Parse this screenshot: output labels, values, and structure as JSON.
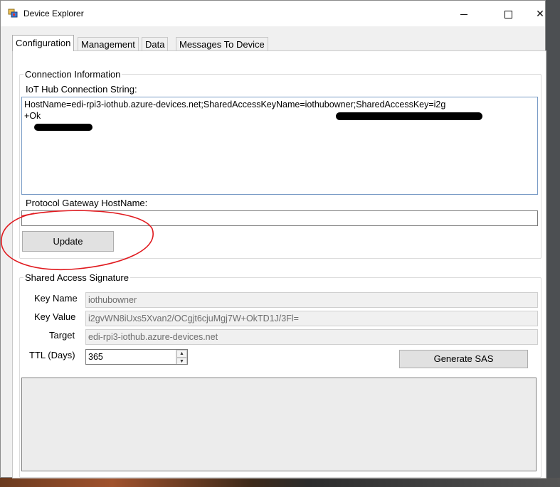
{
  "window": {
    "title": "Device Explorer"
  },
  "tabs": [
    {
      "label": "Configuration",
      "active": true
    },
    {
      "label": "Management",
      "active": false
    },
    {
      "label": "Data",
      "active": false
    },
    {
      "label": "Messages To Device",
      "active": false
    }
  ],
  "connection": {
    "group_label": "Connection Information",
    "conn_string_label": "IoT Hub Connection String:",
    "conn_string_value": "HostName=edi-rpi3-iothub.azure-devices.net;SharedAccessKeyName=iothubowner;SharedAccessKey=i2g",
    "conn_string_line2": "+Ok",
    "gateway_label": "Protocol Gateway HostName:",
    "gateway_value": "",
    "update_label": "Update"
  },
  "sas": {
    "group_label": "Shared Access Signature",
    "key_name_label": "Key Name",
    "key_name_value": "iothubowner",
    "key_value_label": "Key Value",
    "key_value_value": "i2gvWN8iUxs5Xvan2/OCgjt6cjuMgj7W+OkTD1J/3Fl=",
    "target_label": "Target",
    "target_value": "edi-rpi3-iothub.azure-devices.net",
    "ttl_label": "TTL (Days)",
    "ttl_value": "365",
    "generate_label": "Generate SAS"
  },
  "colors": {
    "annotation": "#e0191e",
    "accent": "#7a9cc6"
  }
}
